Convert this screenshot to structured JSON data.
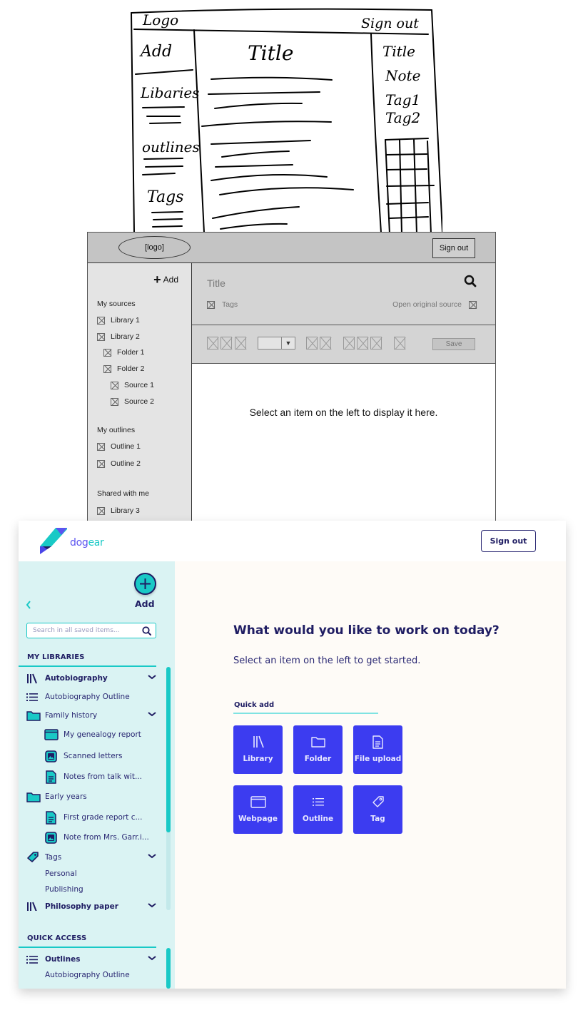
{
  "sketch": {
    "logo": "Logo",
    "sign_out": "Sign out",
    "add": "Add",
    "libraries": "Libaries",
    "outlines": "outlines",
    "tags": "Tags",
    "title": "Title",
    "right_panel": [
      "Title",
      "Note",
      "Tag1",
      "Tag2"
    ]
  },
  "wireframe": {
    "logo": "[logo]",
    "sign_out": "Sign out",
    "add": "Add",
    "title": "Title",
    "tags": "Tags",
    "open_original": "Open original source",
    "save": "Save",
    "empty_message": "Select an item on the left to display it here.",
    "sections": [
      {
        "heading": "My sources",
        "items": [
          {
            "label": "Library 1",
            "level": 0
          },
          {
            "label": "Library 2",
            "level": 0
          },
          {
            "label": "Folder 1",
            "level": 1
          },
          {
            "label": "Folder 2",
            "level": 1
          },
          {
            "label": "Source 1",
            "level": 2
          },
          {
            "label": "Source 2",
            "level": 2
          }
        ]
      },
      {
        "heading": "My outlines",
        "items": [
          {
            "label": "Outline 1",
            "level": 0
          },
          {
            "label": "Outline 2",
            "level": 0
          }
        ]
      },
      {
        "heading": "Shared with me",
        "items": [
          {
            "label": "Library 3",
            "level": 0
          }
        ]
      }
    ]
  },
  "mockup": {
    "brand": {
      "part1": "dog",
      "part2": "ear"
    },
    "sign_out": "Sign out",
    "add_label": "Add",
    "search": {
      "placeholder": "Search in all saved items...",
      "value": ""
    },
    "my_libraries_heading": "MY LIBRARIES",
    "quick_access_heading": "QUICK ACCESS",
    "tree": [
      {
        "label": "Autobiography",
        "icon": "library-icon",
        "level": 0,
        "bold": true,
        "expandable": true
      },
      {
        "label": "Autobiography Outline",
        "icon": "outline-list-icon",
        "level": 0,
        "bold": false
      },
      {
        "label": "Family history",
        "icon": "folder-icon",
        "level": 0,
        "bold": false,
        "expandable": true
      },
      {
        "label": "My genealogy report",
        "icon": "webpage-icon",
        "level": 1,
        "bold": false
      },
      {
        "label": "Scanned letters",
        "icon": "image-icon",
        "level": 1,
        "bold": false
      },
      {
        "label": "Notes from talk wit...",
        "icon": "document-icon",
        "level": 1,
        "bold": false
      },
      {
        "label": "Early years",
        "icon": "folder-icon",
        "level": 0,
        "bold": false
      },
      {
        "label": "First grade report c...",
        "icon": "document-icon",
        "level": 1,
        "bold": false
      },
      {
        "label": "Note from Mrs. Garr.i...",
        "icon": "image-icon",
        "level": 1,
        "bold": false
      },
      {
        "label": "Tags",
        "icon": "tag-icon",
        "level": 0,
        "bold": false,
        "expandable": true
      },
      {
        "label": "Personal",
        "icon": "",
        "level": 0,
        "bold": false
      },
      {
        "label": "Publishing",
        "icon": "",
        "level": 0,
        "bold": false
      },
      {
        "label": "Philosophy paper",
        "icon": "library-icon",
        "level": 0,
        "bold": true,
        "expandable": true
      }
    ],
    "quick_access": [
      {
        "label": "Outlines",
        "icon": "outline-list-icon",
        "bold": true,
        "expandable": true
      },
      {
        "label": "Autobiography Outline",
        "icon": "",
        "bold": false
      }
    ],
    "heading": "What would you like to work on today?",
    "subheading": "Select an item on the left to get started.",
    "quick_add_label": "Quick add",
    "quick_add_tiles": [
      {
        "label": "Library",
        "icon": "library-icon"
      },
      {
        "label": "Folder",
        "icon": "folder-icon"
      },
      {
        "label": "File upload",
        "icon": "file-upload-icon"
      },
      {
        "label": "Webpage",
        "icon": "webpage-icon"
      },
      {
        "label": "Outline",
        "icon": "outline-list-icon"
      },
      {
        "label": "Tag",
        "icon": "tag-icon"
      }
    ],
    "colors": {
      "navy": "#1f1d63",
      "teal": "#19c9c6",
      "sidebar_bg": "#daf3f3",
      "main_bg": "#fefbf7",
      "tile_blue": "#3c3cf0"
    }
  }
}
